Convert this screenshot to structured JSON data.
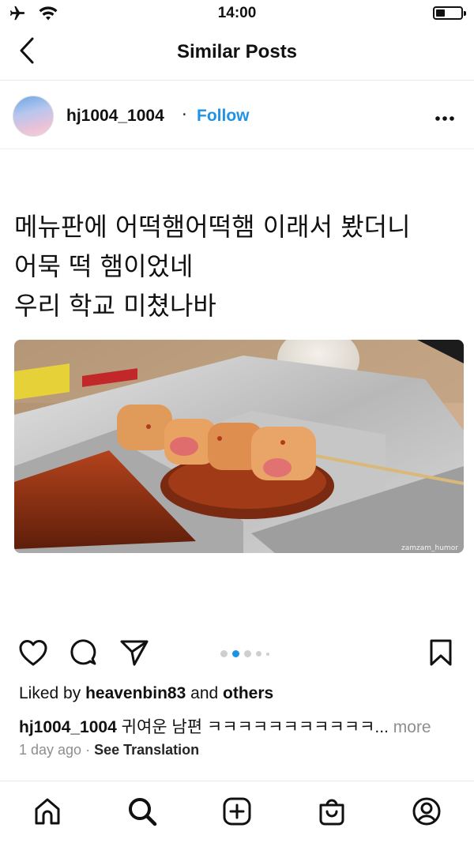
{
  "status_bar": {
    "time": "14:00",
    "battery_level": 0.35,
    "icons": [
      "airplane-icon",
      "wifi-icon",
      "battery-icon"
    ]
  },
  "header": {
    "title": "Similar Posts",
    "back_icon": "chevron-left-icon"
  },
  "post": {
    "username": "hj1004_1004",
    "separator": "·",
    "follow_label": "Follow",
    "more_icon": "ellipsis-icon",
    "image_text": "메뉴판에 어떡햄어떡햄 이래서 봤더니\n어묵 떡 햄이었네\n우리 학교 미쳤나바",
    "photo_watermark": "zamzam_humor",
    "carousel": {
      "count": 5,
      "active_index": 1
    },
    "likes": {
      "prefix": "Liked by",
      "user": "heavenbin83",
      "middle": "and",
      "suffix": "others"
    },
    "caption": {
      "username": "hj1004_1004",
      "text": "귀여운 남편 ㅋㅋㅋㅋㅋㅋㅋㅋㅋㅋㅋ...",
      "more_label": "more"
    },
    "time_ago": "1 day ago",
    "meta_separator": "·",
    "see_translation": "See Translation"
  },
  "actions": [
    "heart-icon",
    "comment-icon",
    "share-icon",
    "bookmark-icon"
  ],
  "bottom_nav": [
    "home-icon",
    "search-icon",
    "create-icon",
    "shop-icon",
    "profile-icon"
  ],
  "colors": {
    "accent": "#1e93e6",
    "muted": "#8e8e8e"
  }
}
